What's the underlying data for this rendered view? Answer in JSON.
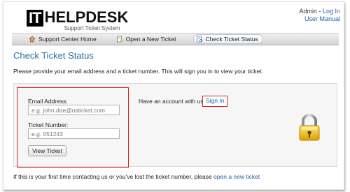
{
  "header": {
    "logo_mark": "IT",
    "logo_name": "HELPDESK",
    "logo_tagline": "Support Ticket System",
    "user_label": "Admin",
    "separator": " - ",
    "login_link": "Log In",
    "manual_link": "User Manual"
  },
  "nav": {
    "items": [
      {
        "label": "Support Center Home",
        "icon": "home-icon"
      },
      {
        "label": "Open a New Ticket",
        "icon": "new-ticket-icon"
      },
      {
        "label": "Check Ticket Status",
        "icon": "ticket-status-icon",
        "active": true
      }
    ]
  },
  "main": {
    "title": "Check Ticket Status",
    "intro": "Please provide your email address and a ticket number. This will sign you in to view your ticket."
  },
  "form": {
    "email_label": "Email Address:",
    "email_placeholder": "e.g. john.doe@osticket.com",
    "ticket_label": "Ticket Number:",
    "ticket_placeholder": "e.g. 051243",
    "submit_label": "View Ticket"
  },
  "account": {
    "prompt": "Have an account with us?",
    "signin_label": "Sign In"
  },
  "footer": {
    "text": "If this is your first time contacting us or you've lost the ticket number, please",
    "link": "open a new ticket"
  },
  "colors": {
    "accent": "#2b6ea5",
    "link": "#1f5fa8",
    "highlight": "#d62020"
  }
}
